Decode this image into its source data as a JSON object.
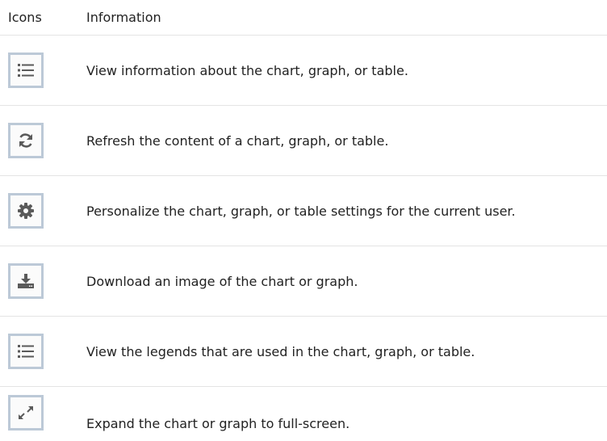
{
  "header": {
    "icons_label": "Icons",
    "information_label": "Information"
  },
  "rows": [
    {
      "icon": "list-icon",
      "text": "View information about the chart, graph, or table."
    },
    {
      "icon": "refresh-icon",
      "text": "Refresh the content of a chart, graph, or table."
    },
    {
      "icon": "gear-icon",
      "text": "Personalize the chart, graph, or table settings for the current user."
    },
    {
      "icon": "download-icon",
      "text": "Download an image of the chart or graph."
    },
    {
      "icon": "list-icon",
      "text": "View the legends that are used in the chart, graph, or table."
    },
    {
      "icon": "expand-icon",
      "text": "Expand the chart or graph to full-screen."
    }
  ],
  "colors": {
    "icon_fill": "#5a5a5a",
    "icon_border": "#bcc9d7",
    "divider": "#e4e4e4"
  }
}
